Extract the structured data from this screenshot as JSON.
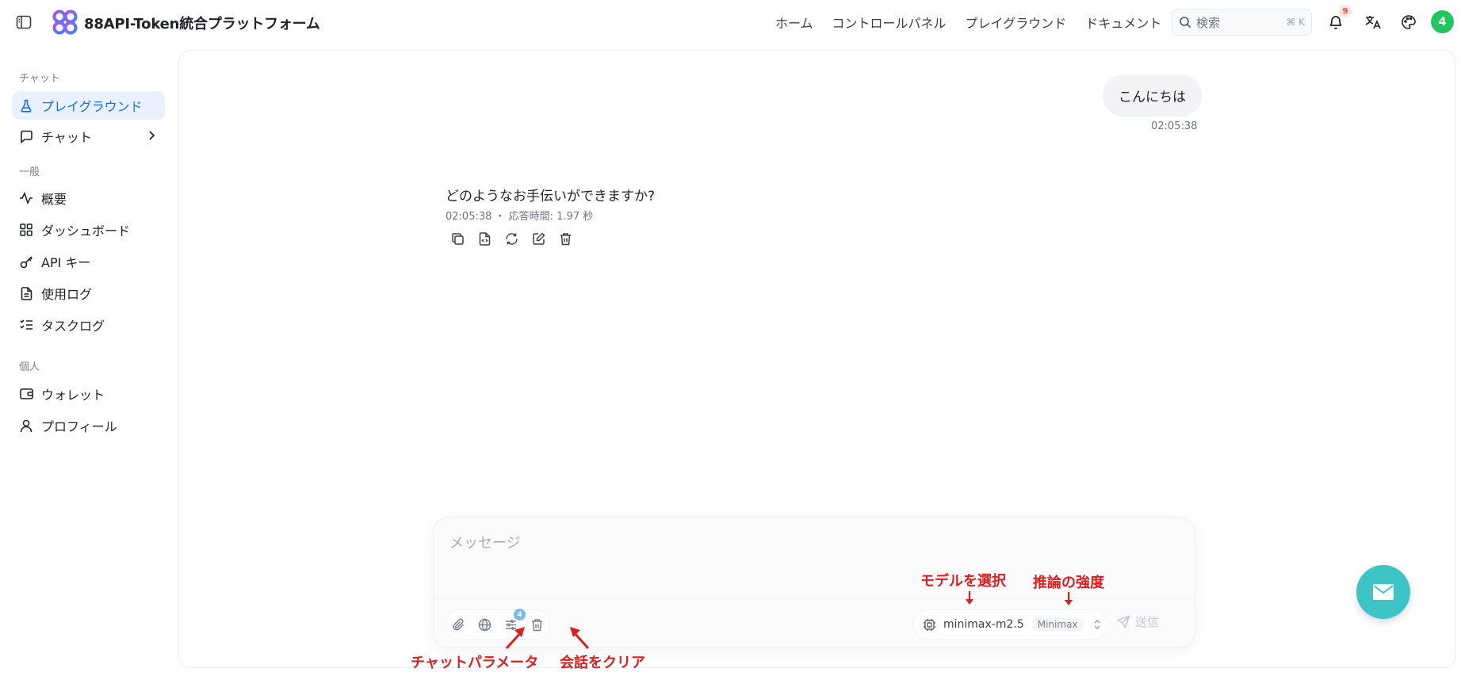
{
  "header": {
    "brand": "88API-Token統合プラットフォーム",
    "nav": [
      "ホーム",
      "コントロールパネル",
      "プレイグラウンド",
      "ドキュメント"
    ],
    "search_placeholder": "検索",
    "search_shortcut": "⌘ K",
    "notification_count": "9",
    "avatar_label": "4",
    "icons": [
      "sidebar-toggle-icon",
      "bell-icon",
      "translate-icon",
      "palette-icon"
    ]
  },
  "sidebar": {
    "section_chat": "チャット",
    "section_general": "一般",
    "section_personal": "個人",
    "items": [
      {
        "label": "プレイグラウンド",
        "icon": "flask-icon",
        "active": true
      },
      {
        "label": "チャット",
        "icon": "message-square-icon",
        "chevron": true
      },
      {
        "label": "概要",
        "icon": "activity-icon"
      },
      {
        "label": "ダッシュボード",
        "icon": "grid-icon"
      },
      {
        "label": "API キー",
        "icon": "key-icon"
      },
      {
        "label": "使用ログ",
        "icon": "file-text-icon"
      },
      {
        "label": "タスクログ",
        "icon": "list-checks-icon"
      },
      {
        "label": "ウォレット",
        "icon": "wallet-icon"
      },
      {
        "label": "プロフィール",
        "icon": "user-icon"
      }
    ]
  },
  "conversation": {
    "user_message": "こんにちは",
    "user_time": "02:05:38",
    "assistant_message": "どのようなお手伝いができますか?",
    "assistant_meta": "02:05:38 ・ 応答時間: 1.97 秒",
    "assistant_actions": [
      "copy-icon",
      "code-file-icon",
      "refresh-icon",
      "edit-icon",
      "trash-icon"
    ]
  },
  "composer": {
    "placeholder": "メッセージ",
    "params_badge": "4",
    "model_name": "minimax-m2.5",
    "model_provider": "Minimax",
    "send_label": "送信"
  },
  "annotations": {
    "model_select": "モデルを選択",
    "reasoning_strength": "推論の強度",
    "chat_params": "チャットパラメータ",
    "clear_chat": "会話をクリア"
  },
  "colors": {
    "accent": "#1d6fe0",
    "active_bg": "#e8f1fd",
    "annotation": "#e11d1d",
    "fab": "#3cc4c7",
    "avatar": "#22c55e"
  }
}
